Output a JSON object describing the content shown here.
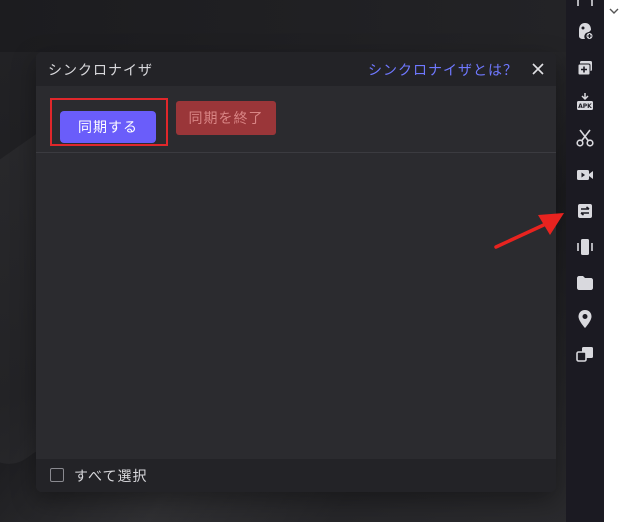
{
  "dialog": {
    "title": "シンクロナイザ",
    "help_link": "シンクロナイザとは？",
    "sync_button": "同期する",
    "stop_button": "同期を終了",
    "select_all_label": "すべて選択"
  },
  "sidebar": {
    "icons": [
      "keyboard-icon",
      "add-app-icon",
      "add-window-icon",
      "apk-install-icon",
      "scissors-icon",
      "video-record-icon",
      "synchronizer-icon",
      "shake-icon",
      "folder-icon",
      "location-icon",
      "multi-instance-icon"
    ]
  },
  "colors": {
    "accent": "#6a5dfa",
    "stop": "#9a3639",
    "help_link": "#6f78ff",
    "highlight_red": "#e0272b"
  }
}
